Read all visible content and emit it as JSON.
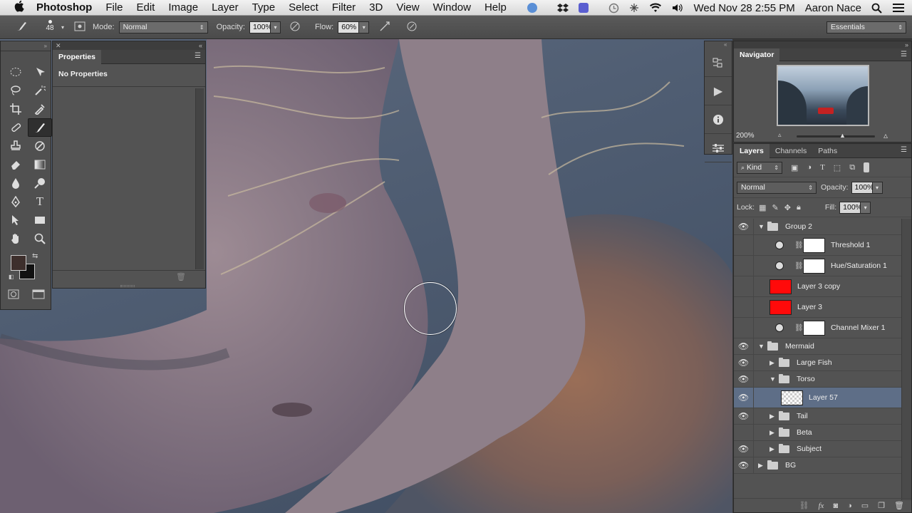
{
  "menubar": {
    "apple_glyph": "",
    "app_name": "Photoshop",
    "items": [
      "File",
      "Edit",
      "Image",
      "Layer",
      "Type",
      "Select",
      "Filter",
      "3D",
      "View",
      "Window",
      "Help"
    ],
    "datetime": "Wed Nov 28  2:55 PM",
    "user": "Aaron Nace"
  },
  "options_bar": {
    "brush_size": "48",
    "mode_label": "Mode:",
    "mode_value": "Normal",
    "opacity_label": "Opacity:",
    "opacity_value": "100%",
    "flow_label": "Flow:",
    "flow_value": "60%",
    "workspace": "Essentials"
  },
  "properties": {
    "tab_label": "Properties",
    "content": "No Properties"
  },
  "navigator": {
    "tab_label": "Navigator",
    "zoom": "200%"
  },
  "layers_panel": {
    "tabs": [
      "Layers",
      "Channels",
      "Paths"
    ],
    "filter_kind": "Kind",
    "blend_mode": "Normal",
    "opacity_label": "Opacity:",
    "opacity_value": "100%",
    "lock_label": "Lock:",
    "fill_label": "Fill:",
    "fill_value": "100%",
    "layers": [
      {
        "name": "Group 2"
      },
      {
        "name": "Threshold 1"
      },
      {
        "name": "Hue/Saturation 1"
      },
      {
        "name": "Layer 3 copy"
      },
      {
        "name": "Layer 3"
      },
      {
        "name": "Channel Mixer 1"
      },
      {
        "name": "Mermaid"
      },
      {
        "name": "Large Fish"
      },
      {
        "name": "Torso"
      },
      {
        "name": "Layer 57"
      },
      {
        "name": "Tail"
      },
      {
        "name": "Beta"
      },
      {
        "name": "Subject"
      },
      {
        "name": "BG"
      }
    ]
  },
  "colors": {
    "foreground": "#3d2f2c",
    "background": "#111111",
    "selected_layer": "#5e6e87",
    "red_fill": "#ff0a0a"
  }
}
